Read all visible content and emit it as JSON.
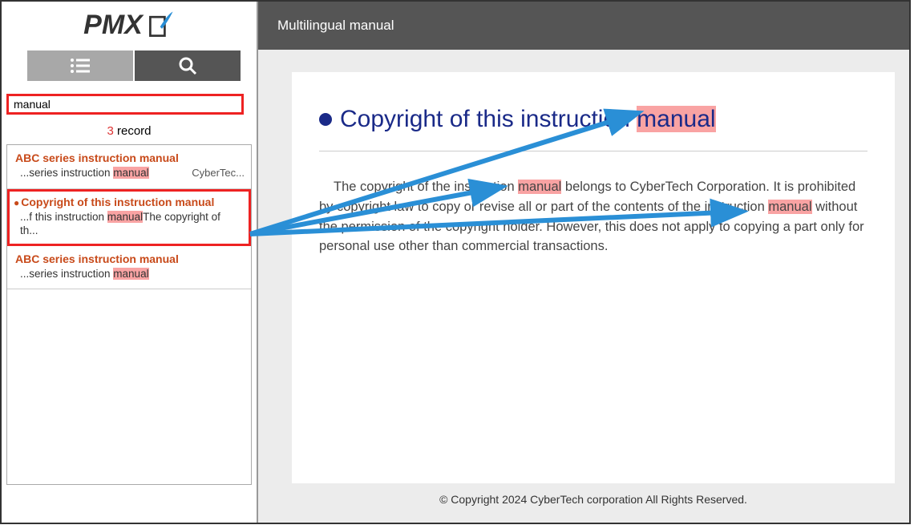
{
  "app": {
    "logo_text": "PMX",
    "header_title": "Multilingual manual"
  },
  "search": {
    "value": "manual",
    "record_count": "3",
    "record_label": " record"
  },
  "results": [
    {
      "title": "ABC series instruction manual",
      "snippet_pre": "...series instruction ",
      "snippet_hl": "manual",
      "snippet_post": "",
      "meta": "CyberTec...",
      "selected": false,
      "bullet": ""
    },
    {
      "title": "Copyright of this instruction manual",
      "snippet_pre": "...f this instruction ",
      "snippet_hl": "manual",
      "snippet_post": "The copyright of th...",
      "meta": "",
      "selected": true,
      "bullet": "●"
    },
    {
      "title": "ABC series instruction manual",
      "snippet_pre": "...series instruction ",
      "snippet_hl": "manual",
      "snippet_post": "",
      "meta": "",
      "selected": false,
      "bullet": ""
    }
  ],
  "document": {
    "heading_pre": "Copyright of this instruction ",
    "heading_hl": "manual",
    "body_1": "The copyright of the instruction ",
    "body_hl1": "manual",
    "body_2": " belongs to CyberTech Corporation. It is prohibited by copyright law to copy or revise all or part of the contents of the instruction ",
    "body_hl2": "manual",
    "body_3": " without the permission of the copyright holder. However, this does not apply to copying a part only for personal use other than commercial transactions."
  },
  "footer": {
    "text": "© Copyright  2024 CyberTech corporation  All  Rights  Reserved."
  }
}
